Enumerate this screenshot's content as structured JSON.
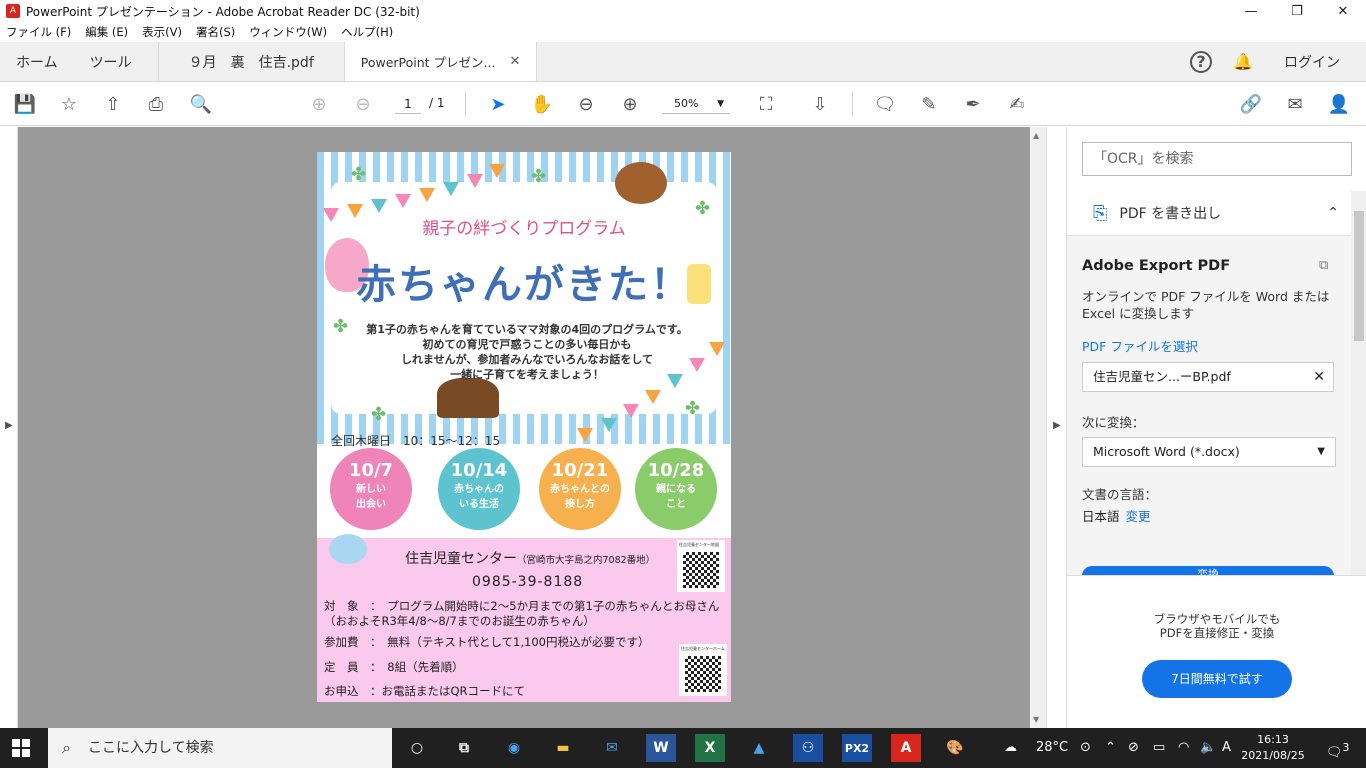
{
  "window": {
    "title": "PowerPoint プレゼンテーション - Adobe Acrobat Reader DC (32-bit)",
    "app_icon": "pdf-icon",
    "controls": [
      "—",
      "❐",
      "✕"
    ]
  },
  "menu": [
    "ファイル (F)",
    "編集 (E)",
    "表示(V)",
    "署名(S)",
    "ウィンドウ(W)",
    "ヘルプ(H)"
  ],
  "tabs": {
    "home": "ホーム",
    "tools": "ツール",
    "doc1": "９月　裏　住吉.pdf",
    "doc2": "PowerPoint プレゼン...",
    "close": "✕"
  },
  "header": {
    "login": "ログイン",
    "help": "?"
  },
  "toolbar": {
    "page_current": "1",
    "page_total": "/ 1",
    "zoom": "50%"
  },
  "panel": {
    "search_placeholder": "「OCR」を検索",
    "export_title": "PDF を書き出し",
    "heading": "Adobe Export PDF",
    "description": "オンラインで PDF ファイルを Word または Excel に変換します",
    "select_link": "PDF ファイルを選択",
    "file_name": "住吉児童セン...ーBP.pdf",
    "convert_to_label": "次に変換：",
    "convert_to_value": "Microsoft Word (*.docx)",
    "lang_label": "文書の言語：",
    "lang_value": "日本語",
    "lang_change": "変更",
    "convert_button": "変換",
    "promo_line1": "ブラウザやモバイルでも",
    "promo_line2": "PDFを直接修正・変換",
    "trial_button": "7日間無料で試す"
  },
  "flyer": {
    "subtitle": "親子の絆づくりプログラム",
    "title": "赤ちゃんがきた！",
    "desc1": "第1子の赤ちゃんを育てているママ対象の4回のプログラムです。",
    "desc2": "初めての育児で戸惑うことの多い毎日かも",
    "desc3": "しれませんが、参加者みんなでいろんなお話をして",
    "desc4": "一緒に子育てを考えましょう！",
    "days": "全回木曜日　10：15～12：15",
    "sessions": [
      {
        "date": "10/7",
        "l1": "新しい",
        "l2": "出会い",
        "color": "#ee84b8"
      },
      {
        "date": "10/14",
        "l1": "赤ちゃんの",
        "l2": "いる生活",
        "color": "#5cc3cf"
      },
      {
        "date": "10/21",
        "l1": "赤ちゃんとの",
        "l2": "接し方",
        "color": "#f6b04e"
      },
      {
        "date": "10/28",
        "l1": "親になる",
        "l2": "こと",
        "color": "#8bcc6a"
      }
    ],
    "center": "住吉児童センター",
    "address": "（宮崎市大字島之内7082番地）",
    "tel": "0985-39-8188",
    "target": "対　象　：　プログラム開始時に2～5か月までの第1子の赤ちゃんとお母さん",
    "target2": "（おおよそR3年4/8～8/7までのお誕生の赤ちゃん）",
    "fee": "参加費　：　無料（テキスト代として1,100円税込が必要です）",
    "capacity": "定　員　：　8組（先着順）",
    "apply": "お申込　：お電話またはQRコードにて",
    "qr1_caption": "住吉児童センター地図",
    "qr2_caption": "住吉児童センターホーム"
  },
  "taskbar": {
    "search": "ここに入力して検索",
    "weather": "28°C",
    "ime": "A",
    "time": "16:13",
    "date": "2021/08/25",
    "notifications": "3"
  }
}
